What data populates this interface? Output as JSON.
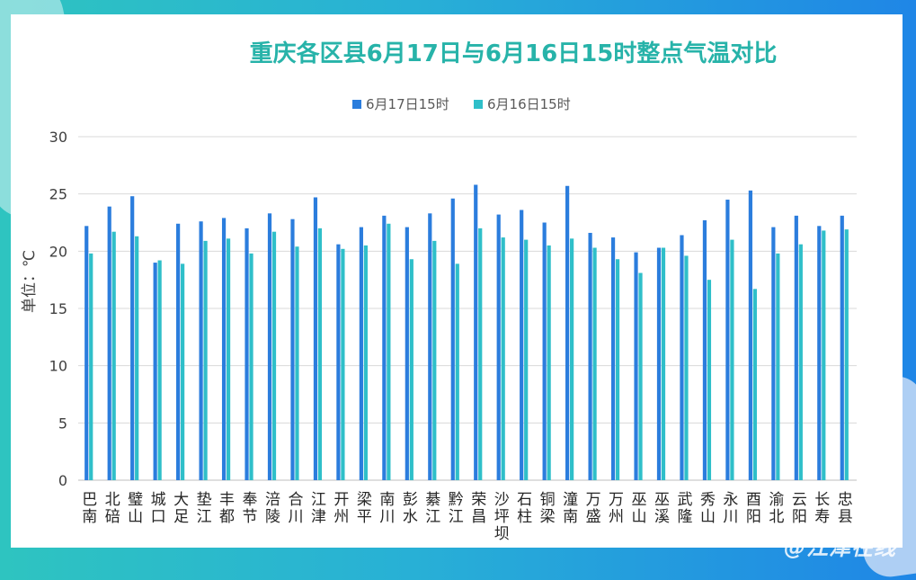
{
  "chart_data": {
    "type": "bar",
    "title": "重庆各区县6月17日与6月16日15时整点气温对比",
    "ylabel": "单位：℃",
    "xlabel": "",
    "ylim": [
      0,
      30
    ],
    "yticks": [
      0,
      5,
      10,
      15,
      20,
      25,
      30
    ],
    "grid": true,
    "legend_position": "top",
    "categories": [
      "巴南",
      "北碚",
      "璧山",
      "城口",
      "大足",
      "垫江",
      "丰都",
      "奉节",
      "涪陵",
      "合川",
      "江津",
      "开州",
      "梁平",
      "南川",
      "彭水",
      "綦江",
      "黔江",
      "荣昌",
      "沙坪坝",
      "石柱",
      "铜梁",
      "潼南",
      "万盛",
      "万州",
      "巫山",
      "巫溪",
      "武隆",
      "秀山",
      "永川",
      "酉阳",
      "渝北",
      "云阳",
      "长寿",
      "忠县"
    ],
    "series": [
      {
        "name": "6月17日15时",
        "color": "#2b7ddd",
        "values": [
          22.2,
          23.9,
          24.8,
          19.0,
          22.4,
          22.6,
          22.9,
          22.0,
          23.3,
          22.8,
          24.7,
          20.6,
          22.1,
          23.1,
          22.1,
          23.3,
          24.6,
          25.8,
          23.2,
          23.6,
          22.5,
          25.7,
          21.6,
          21.2,
          19.9,
          20.3,
          21.4,
          22.7,
          24.5,
          25.3,
          22.1,
          23.1,
          22.2,
          23.1
        ]
      },
      {
        "name": "6月16日15时",
        "color": "#2fbfc9",
        "values": [
          19.8,
          21.7,
          21.3,
          19.2,
          18.9,
          20.9,
          21.1,
          19.8,
          21.7,
          20.4,
          22.0,
          20.2,
          20.5,
          22.4,
          19.3,
          20.9,
          18.9,
          22.0,
          21.2,
          21.0,
          20.5,
          21.1,
          20.3,
          19.3,
          18.1,
          20.3,
          19.6,
          17.5,
          21.0,
          16.7,
          19.8,
          20.6,
          21.8,
          21.9
        ]
      }
    ]
  },
  "watermark": "@江津在线"
}
